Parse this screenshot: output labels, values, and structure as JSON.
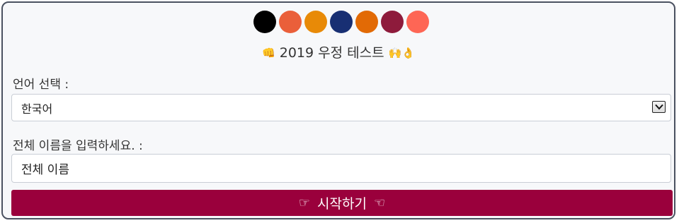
{
  "theme_colors": [
    "#000000",
    "#ea5f3a",
    "#e88a07",
    "#182f73",
    "#e26a05",
    "#8e1b3c",
    "#fe6655"
  ],
  "title": {
    "leading_emoji": "👊",
    "text": "2019 우정 테스트",
    "trailing_emoji": "🙌👌"
  },
  "language": {
    "label": "언어 선택 :",
    "selected": "한국어"
  },
  "name": {
    "label": "전체 이름을 입력하세요. :",
    "placeholder": "전체 이름"
  },
  "start_button": {
    "left_icon": "☞",
    "label": "시작하기",
    "right_icon": "☜"
  }
}
